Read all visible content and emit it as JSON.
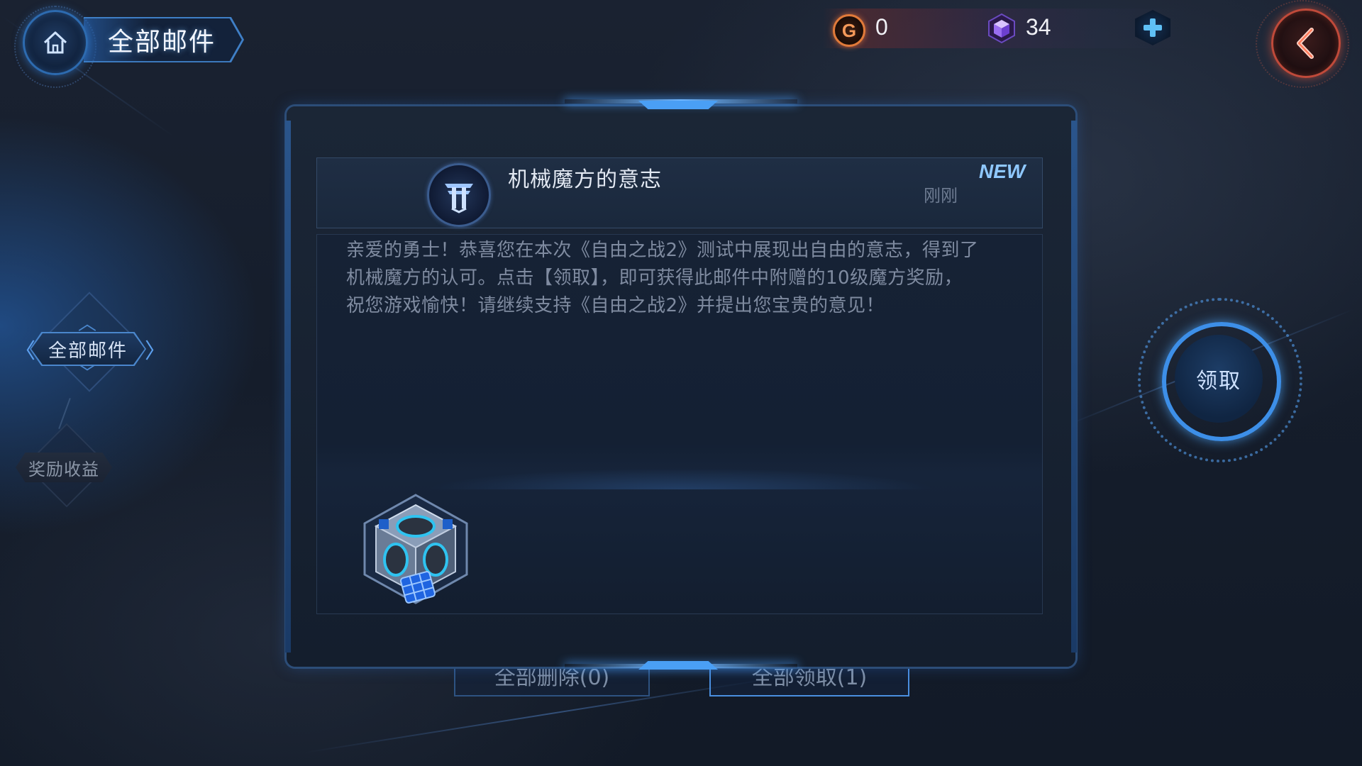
{
  "header": {
    "title": "全部邮件"
  },
  "currency": {
    "gold_symbol": "G",
    "gold": "0",
    "cubes": "34"
  },
  "nav": {
    "active_label": "全部邮件",
    "inactive_label": "奖励收益"
  },
  "mail": {
    "subject": "机械魔方的意志",
    "badge": "NEW",
    "time": "刚刚",
    "body_lines": [
      "亲爱的勇士！恭喜您在本次《自由之战2》测试中展现出自由的意志，得到了",
      "机械魔方的认可。点击【领取】，即可获得此邮件中附赠的10级魔方奖励，",
      "祝您游戏愉快！请继续支持《自由之战2》并提出您宝贵的意见！"
    ]
  },
  "actions": {
    "claim_label": "领取",
    "delete_all_label": "全部删除(0)",
    "claim_all_label": "全部领取(1)"
  },
  "icons": {
    "home": "home-icon",
    "back": "back-arrow-icon",
    "add": "plus-icon",
    "gold": "gold-coin-icon",
    "gem": "cube-gem-icon",
    "sender": "sender-emblem-icon",
    "reward": "mechanical-cube-icon"
  },
  "colors": {
    "accent": "#3d8fe8",
    "gold": "#e07a3a",
    "back": "#c04a3a",
    "new_badge": "#8fc8ff"
  }
}
